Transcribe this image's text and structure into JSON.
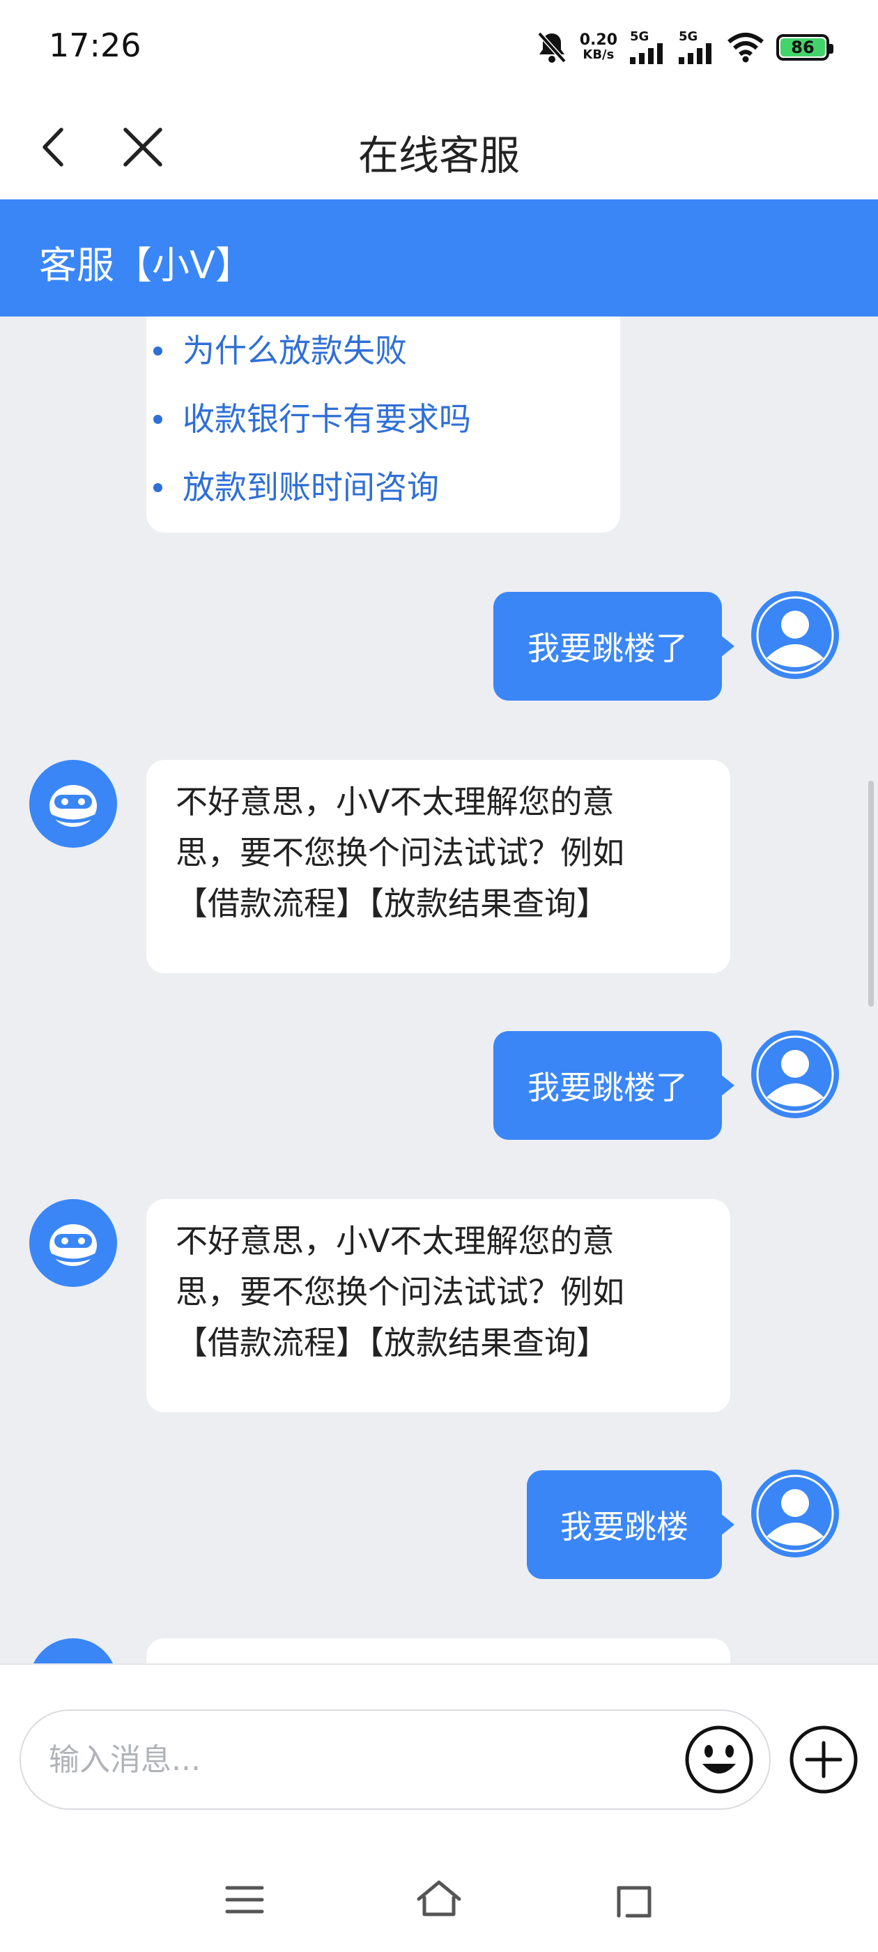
{
  "status_bar": {
    "time": "17:26",
    "net_speed_value": "0.20",
    "net_speed_unit": "KB/s",
    "signal_1": "5G",
    "signal_2": "5G",
    "battery": "86"
  },
  "header": {
    "title": "在线客服",
    "agent_name": "客服【小V】"
  },
  "faq": {
    "items": [
      "为什么放款失败",
      "收款银行卡有要求吗",
      "放款到账时间咨询"
    ]
  },
  "messages": [
    {
      "from": "user",
      "text": "我要跳楼了"
    },
    {
      "from": "agent",
      "lines": [
        "不好意思，小V不太理解您的意",
        "思，要不您换个问法试试？例如",
        "【借款流程】【放款结果查询】"
      ]
    },
    {
      "from": "user",
      "text": "我要跳楼了"
    },
    {
      "from": "agent",
      "lines": [
        "不好意思，小V不太理解您的意",
        "思，要不您换个问法试试？例如",
        "【借款流程】【放款结果查询】"
      ]
    },
    {
      "from": "user",
      "text": "我要跳楼"
    }
  ],
  "input": {
    "placeholder": "输入消息..."
  },
  "colors": {
    "brand": "#3a86f7",
    "link": "#2f6fd6",
    "chat_bg": "#eceef1",
    "battery": "#43d36b"
  },
  "icons": {
    "back": "chevron-left-icon",
    "close": "close-icon",
    "emoji": "emoji-icon",
    "plus": "plus-icon",
    "agent_avatar": "robot-icon",
    "user_avatar": "person-icon"
  }
}
